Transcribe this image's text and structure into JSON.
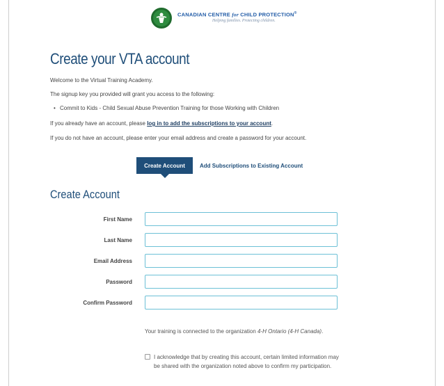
{
  "header": {
    "org_name_part1": "CANADIAN CENTRE ",
    "org_name_for": "for",
    "org_name_part2": " CHILD PROTECTION",
    "org_reg_mark": "®",
    "tagline": "Helping families. Protecting children."
  },
  "page": {
    "title": "Create your VTA account",
    "welcome": "Welcome to the Virtual Training Academy.",
    "signup_key_text": "The signup key you provided will grant you access to the following:",
    "access_items": [
      "Commit to Kids - Child Sexual Abuse Prevention Training for those Working with Children"
    ],
    "existing_prefix": "If you already have an account, please ",
    "existing_link": "log in to add the subscriptions to your account",
    "existing_suffix": ".",
    "new_account_text": "If you do not have an account, please enter your email address and create a password for your account."
  },
  "tabs": {
    "create": "Create Account",
    "add": "Add Subscriptions to Existing Account"
  },
  "form": {
    "section_title": "Create Account",
    "fields": [
      {
        "label": "First Name",
        "value": ""
      },
      {
        "label": "Last Name",
        "value": ""
      },
      {
        "label": "Email Address",
        "value": ""
      },
      {
        "label": "Password",
        "value": ""
      },
      {
        "label": "Confirm Password",
        "value": ""
      }
    ],
    "org_prefix": "Your training is connected to the organization ",
    "org_name": "4-H Ontario (4-H Canada)",
    "org_suffix": ".",
    "ack_checked": false,
    "ack_text": "I acknowledge that by creating this account, certain limited information may be shared with the organization noted above to confirm my participation."
  },
  "colors": {
    "brand_blue": "#1f4e79",
    "input_border": "#6cc0d6",
    "logo_green": "#2e8b3f"
  }
}
